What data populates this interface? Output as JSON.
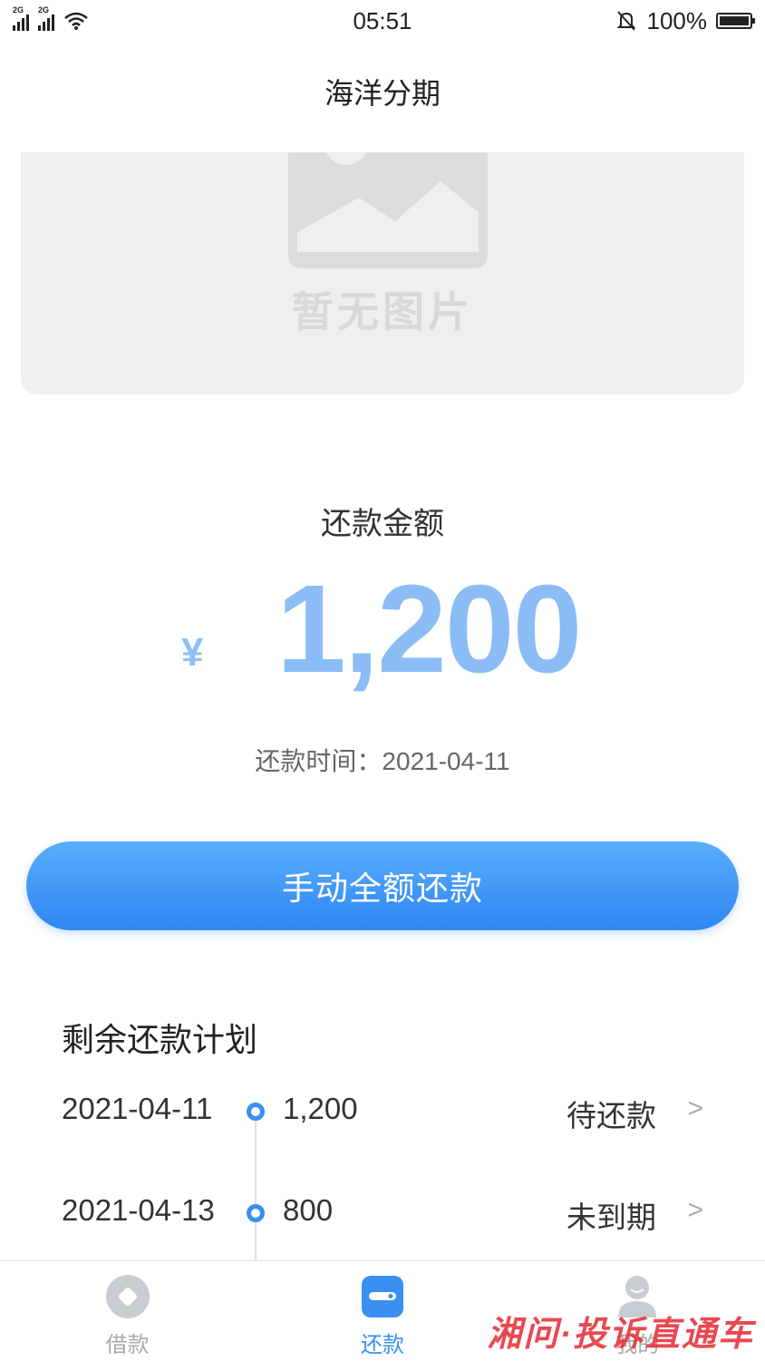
{
  "status_bar": {
    "sim1": "2G",
    "sim2": "2G",
    "time": "05:51",
    "battery": "100%"
  },
  "nav": {
    "title": "海洋分期"
  },
  "banner": {
    "placeholder_text": "暂无图片"
  },
  "repayment": {
    "label": "还款金额",
    "currency": "¥",
    "amount": "1,200",
    "due_date": "还款时间：2021-04-11"
  },
  "actions": {
    "repay_button": "手动全额还款"
  },
  "plan": {
    "title": "剩余还款计划",
    "rows": [
      {
        "date": "2021-04-11",
        "amount": "1,200",
        "status": "待还款"
      },
      {
        "date": "2021-04-13",
        "amount": "800",
        "status": "未到期"
      }
    ]
  },
  "tabbar": {
    "tabs": [
      {
        "label": "借款",
        "icon": "loan-icon"
      },
      {
        "label": "还款",
        "icon": "wallet-icon",
        "active": true
      },
      {
        "label": "我的",
        "icon": "profile-icon"
      }
    ]
  },
  "watermark": "湘问·投诉直通车",
  "colors": {
    "accent": "#3b8ef2",
    "amount": "#8bbcf6",
    "button_top": "#5aaefc",
    "button_bottom": "#2f86f2"
  }
}
